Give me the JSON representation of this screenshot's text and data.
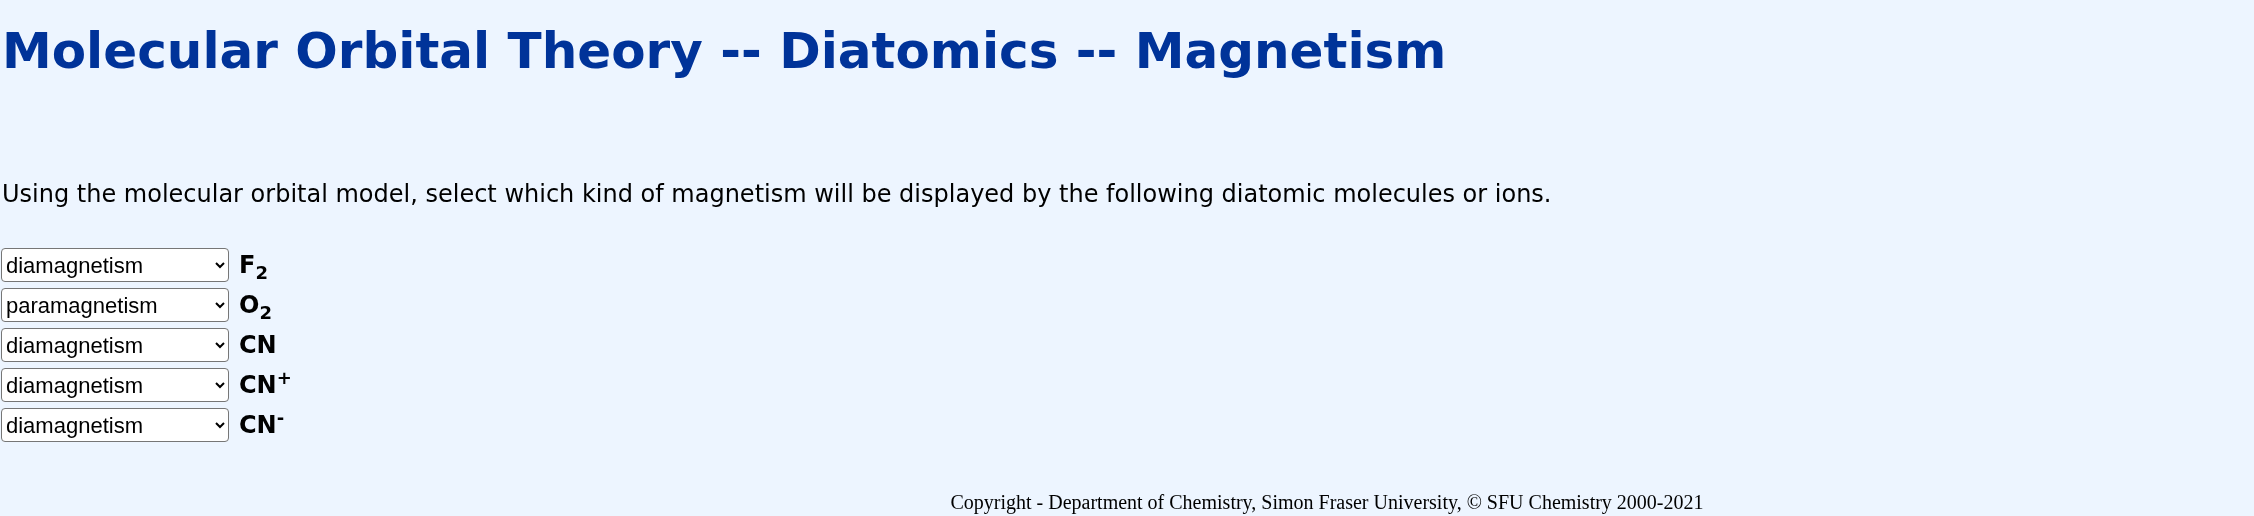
{
  "title": "Molecular Orbital Theory -- Diatomics -- Magnetism",
  "instructions": "Using the molecular orbital model, select which kind of magnetism will be displayed by the following diatomic molecules or ions.",
  "questions": [
    {
      "answer": "diamagnetism",
      "formula": "F$_{2}$"
    },
    {
      "answer": "paramagnetism",
      "formula": "O$_{2}$"
    },
    {
      "answer": "diamagnetism",
      "formula": "CN"
    },
    {
      "answer": "diamagnetism",
      "formula": "CN$^{+}$"
    },
    {
      "answer": "diamagnetism",
      "formula": "CN$^{-}$"
    }
  ],
  "footer": "Copyright - Department of Chemistry, Simon Fraser University, © SFU Chemistry 2000-2021"
}
